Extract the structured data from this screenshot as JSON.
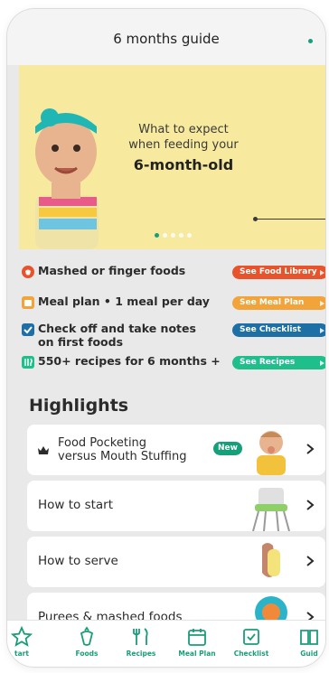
{
  "header": {
    "title": "6 months guide"
  },
  "hero": {
    "line1": "What to expect",
    "line2": "when feeding your",
    "line3": "6-month-old",
    "slides": 5,
    "active_slide": 1
  },
  "features": [
    {
      "text": "Mashed or finger foods",
      "button": "See Food Library",
      "color": "#e8532c",
      "icon": "food-icon"
    },
    {
      "text": "Meal plan • 1 meal per day",
      "button": "See Meal Plan",
      "color": "#f2a33a",
      "icon": "calendar-icon"
    },
    {
      "text_line1": "Check off and take notes",
      "text_line2": "on first foods",
      "button": "See Checklist",
      "color": "#1e6fa6",
      "icon": "checklist-icon"
    },
    {
      "text": "550+ recipes for 6 months +",
      "button": "See Recipes",
      "color": "#1ebf8a",
      "icon": "recipes-icon"
    }
  ],
  "highlights": {
    "title": "Highlights",
    "cards": [
      {
        "line1": "Food Pocketing",
        "line2": "versus Mouth Stuffing",
        "badge": "New"
      },
      {
        "label": "How to start"
      },
      {
        "label": "How to serve"
      },
      {
        "label": "Purees & mashed foods"
      }
    ]
  },
  "tabbar": {
    "tabs": [
      {
        "label": "tart",
        "icon": "star-icon"
      },
      {
        "label": "Foods",
        "icon": "carrot-icon"
      },
      {
        "label": "Recipes",
        "icon": "utensils-icon"
      },
      {
        "label": "Meal Plan",
        "icon": "calendar-icon"
      },
      {
        "label": "Checklist",
        "icon": "checklist-icon"
      },
      {
        "label": "Guid",
        "icon": "book-icon"
      }
    ]
  },
  "colors": {
    "accent": "#16a07a",
    "hero_bg": "#f7ea9e",
    "page_bg": "#e9e9e9"
  }
}
